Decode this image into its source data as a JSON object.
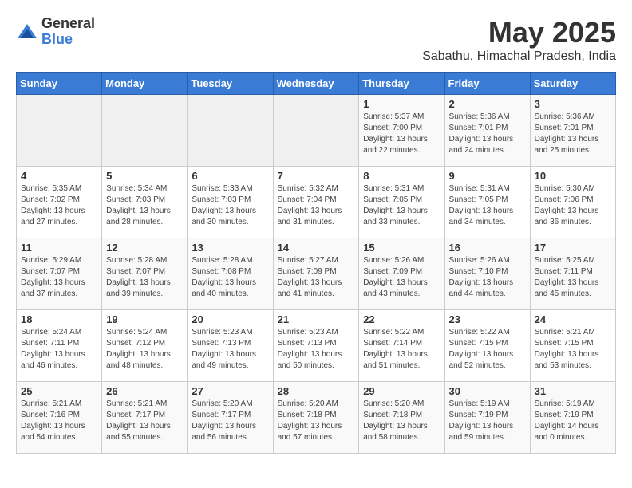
{
  "logo": {
    "general": "General",
    "blue": "Blue"
  },
  "title": "May 2025",
  "subtitle": "Sabathu, Himachal Pradesh, India",
  "weekdays": [
    "Sunday",
    "Monday",
    "Tuesday",
    "Wednesday",
    "Thursday",
    "Friday",
    "Saturday"
  ],
  "weeks": [
    [
      {
        "day": "",
        "info": ""
      },
      {
        "day": "",
        "info": ""
      },
      {
        "day": "",
        "info": ""
      },
      {
        "day": "",
        "info": ""
      },
      {
        "day": "1",
        "info": "Sunrise: 5:37 AM\nSunset: 7:00 PM\nDaylight: 13 hours and 22 minutes."
      },
      {
        "day": "2",
        "info": "Sunrise: 5:36 AM\nSunset: 7:01 PM\nDaylight: 13 hours and 24 minutes."
      },
      {
        "day": "3",
        "info": "Sunrise: 5:36 AM\nSunset: 7:01 PM\nDaylight: 13 hours and 25 minutes."
      }
    ],
    [
      {
        "day": "4",
        "info": "Sunrise: 5:35 AM\nSunset: 7:02 PM\nDaylight: 13 hours and 27 minutes."
      },
      {
        "day": "5",
        "info": "Sunrise: 5:34 AM\nSunset: 7:03 PM\nDaylight: 13 hours and 28 minutes."
      },
      {
        "day": "6",
        "info": "Sunrise: 5:33 AM\nSunset: 7:03 PM\nDaylight: 13 hours and 30 minutes."
      },
      {
        "day": "7",
        "info": "Sunrise: 5:32 AM\nSunset: 7:04 PM\nDaylight: 13 hours and 31 minutes."
      },
      {
        "day": "8",
        "info": "Sunrise: 5:31 AM\nSunset: 7:05 PM\nDaylight: 13 hours and 33 minutes."
      },
      {
        "day": "9",
        "info": "Sunrise: 5:31 AM\nSunset: 7:05 PM\nDaylight: 13 hours and 34 minutes."
      },
      {
        "day": "10",
        "info": "Sunrise: 5:30 AM\nSunset: 7:06 PM\nDaylight: 13 hours and 36 minutes."
      }
    ],
    [
      {
        "day": "11",
        "info": "Sunrise: 5:29 AM\nSunset: 7:07 PM\nDaylight: 13 hours and 37 minutes."
      },
      {
        "day": "12",
        "info": "Sunrise: 5:28 AM\nSunset: 7:07 PM\nDaylight: 13 hours and 39 minutes."
      },
      {
        "day": "13",
        "info": "Sunrise: 5:28 AM\nSunset: 7:08 PM\nDaylight: 13 hours and 40 minutes."
      },
      {
        "day": "14",
        "info": "Sunrise: 5:27 AM\nSunset: 7:09 PM\nDaylight: 13 hours and 41 minutes."
      },
      {
        "day": "15",
        "info": "Sunrise: 5:26 AM\nSunset: 7:09 PM\nDaylight: 13 hours and 43 minutes."
      },
      {
        "day": "16",
        "info": "Sunrise: 5:26 AM\nSunset: 7:10 PM\nDaylight: 13 hours and 44 minutes."
      },
      {
        "day": "17",
        "info": "Sunrise: 5:25 AM\nSunset: 7:11 PM\nDaylight: 13 hours and 45 minutes."
      }
    ],
    [
      {
        "day": "18",
        "info": "Sunrise: 5:24 AM\nSunset: 7:11 PM\nDaylight: 13 hours and 46 minutes."
      },
      {
        "day": "19",
        "info": "Sunrise: 5:24 AM\nSunset: 7:12 PM\nDaylight: 13 hours and 48 minutes."
      },
      {
        "day": "20",
        "info": "Sunrise: 5:23 AM\nSunset: 7:13 PM\nDaylight: 13 hours and 49 minutes."
      },
      {
        "day": "21",
        "info": "Sunrise: 5:23 AM\nSunset: 7:13 PM\nDaylight: 13 hours and 50 minutes."
      },
      {
        "day": "22",
        "info": "Sunrise: 5:22 AM\nSunset: 7:14 PM\nDaylight: 13 hours and 51 minutes."
      },
      {
        "day": "23",
        "info": "Sunrise: 5:22 AM\nSunset: 7:15 PM\nDaylight: 13 hours and 52 minutes."
      },
      {
        "day": "24",
        "info": "Sunrise: 5:21 AM\nSunset: 7:15 PM\nDaylight: 13 hours and 53 minutes."
      }
    ],
    [
      {
        "day": "25",
        "info": "Sunrise: 5:21 AM\nSunset: 7:16 PM\nDaylight: 13 hours and 54 minutes."
      },
      {
        "day": "26",
        "info": "Sunrise: 5:21 AM\nSunset: 7:17 PM\nDaylight: 13 hours and 55 minutes."
      },
      {
        "day": "27",
        "info": "Sunrise: 5:20 AM\nSunset: 7:17 PM\nDaylight: 13 hours and 56 minutes."
      },
      {
        "day": "28",
        "info": "Sunrise: 5:20 AM\nSunset: 7:18 PM\nDaylight: 13 hours and 57 minutes."
      },
      {
        "day": "29",
        "info": "Sunrise: 5:20 AM\nSunset: 7:18 PM\nDaylight: 13 hours and 58 minutes."
      },
      {
        "day": "30",
        "info": "Sunrise: 5:19 AM\nSunset: 7:19 PM\nDaylight: 13 hours and 59 minutes."
      },
      {
        "day": "31",
        "info": "Sunrise: 5:19 AM\nSunset: 7:19 PM\nDaylight: 14 hours and 0 minutes."
      }
    ]
  ]
}
